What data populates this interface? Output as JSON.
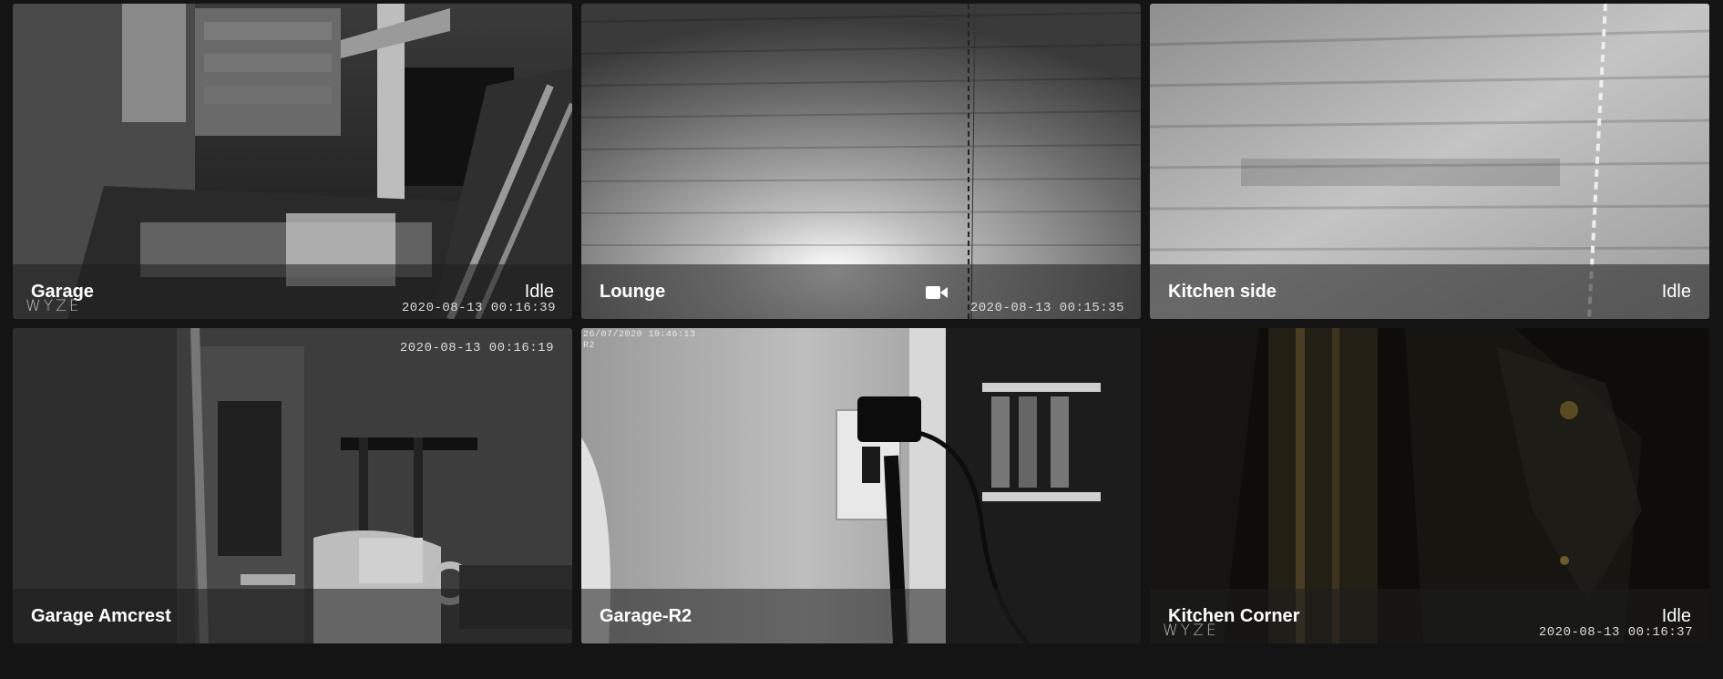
{
  "cameras": [
    {
      "name": "Garage",
      "state": "Idle",
      "timestamp": "2020-08-13  00:16:39",
      "watermark": "WYZE"
    },
    {
      "name": "Lounge",
      "state_icon": "video-camera-icon",
      "timestamp": "2020-08-13  00:15:35"
    },
    {
      "name": "Kitchen side",
      "state": "Idle"
    },
    {
      "name": "Garage Amcrest",
      "timestamp": "2020-08-13 00:16:19"
    },
    {
      "name": "Garage-R2",
      "osd_date": "26/07/2020 10:46:13",
      "osd_label": "R2"
    },
    {
      "name": "Kitchen Corner",
      "state": "Idle",
      "timestamp": "2020-08-13  00:16:37",
      "watermark": "WYZE"
    }
  ],
  "colors": {
    "background": "#141414",
    "overlay": "rgba(30,30,30,0.55)",
    "text": "#ffffff"
  }
}
